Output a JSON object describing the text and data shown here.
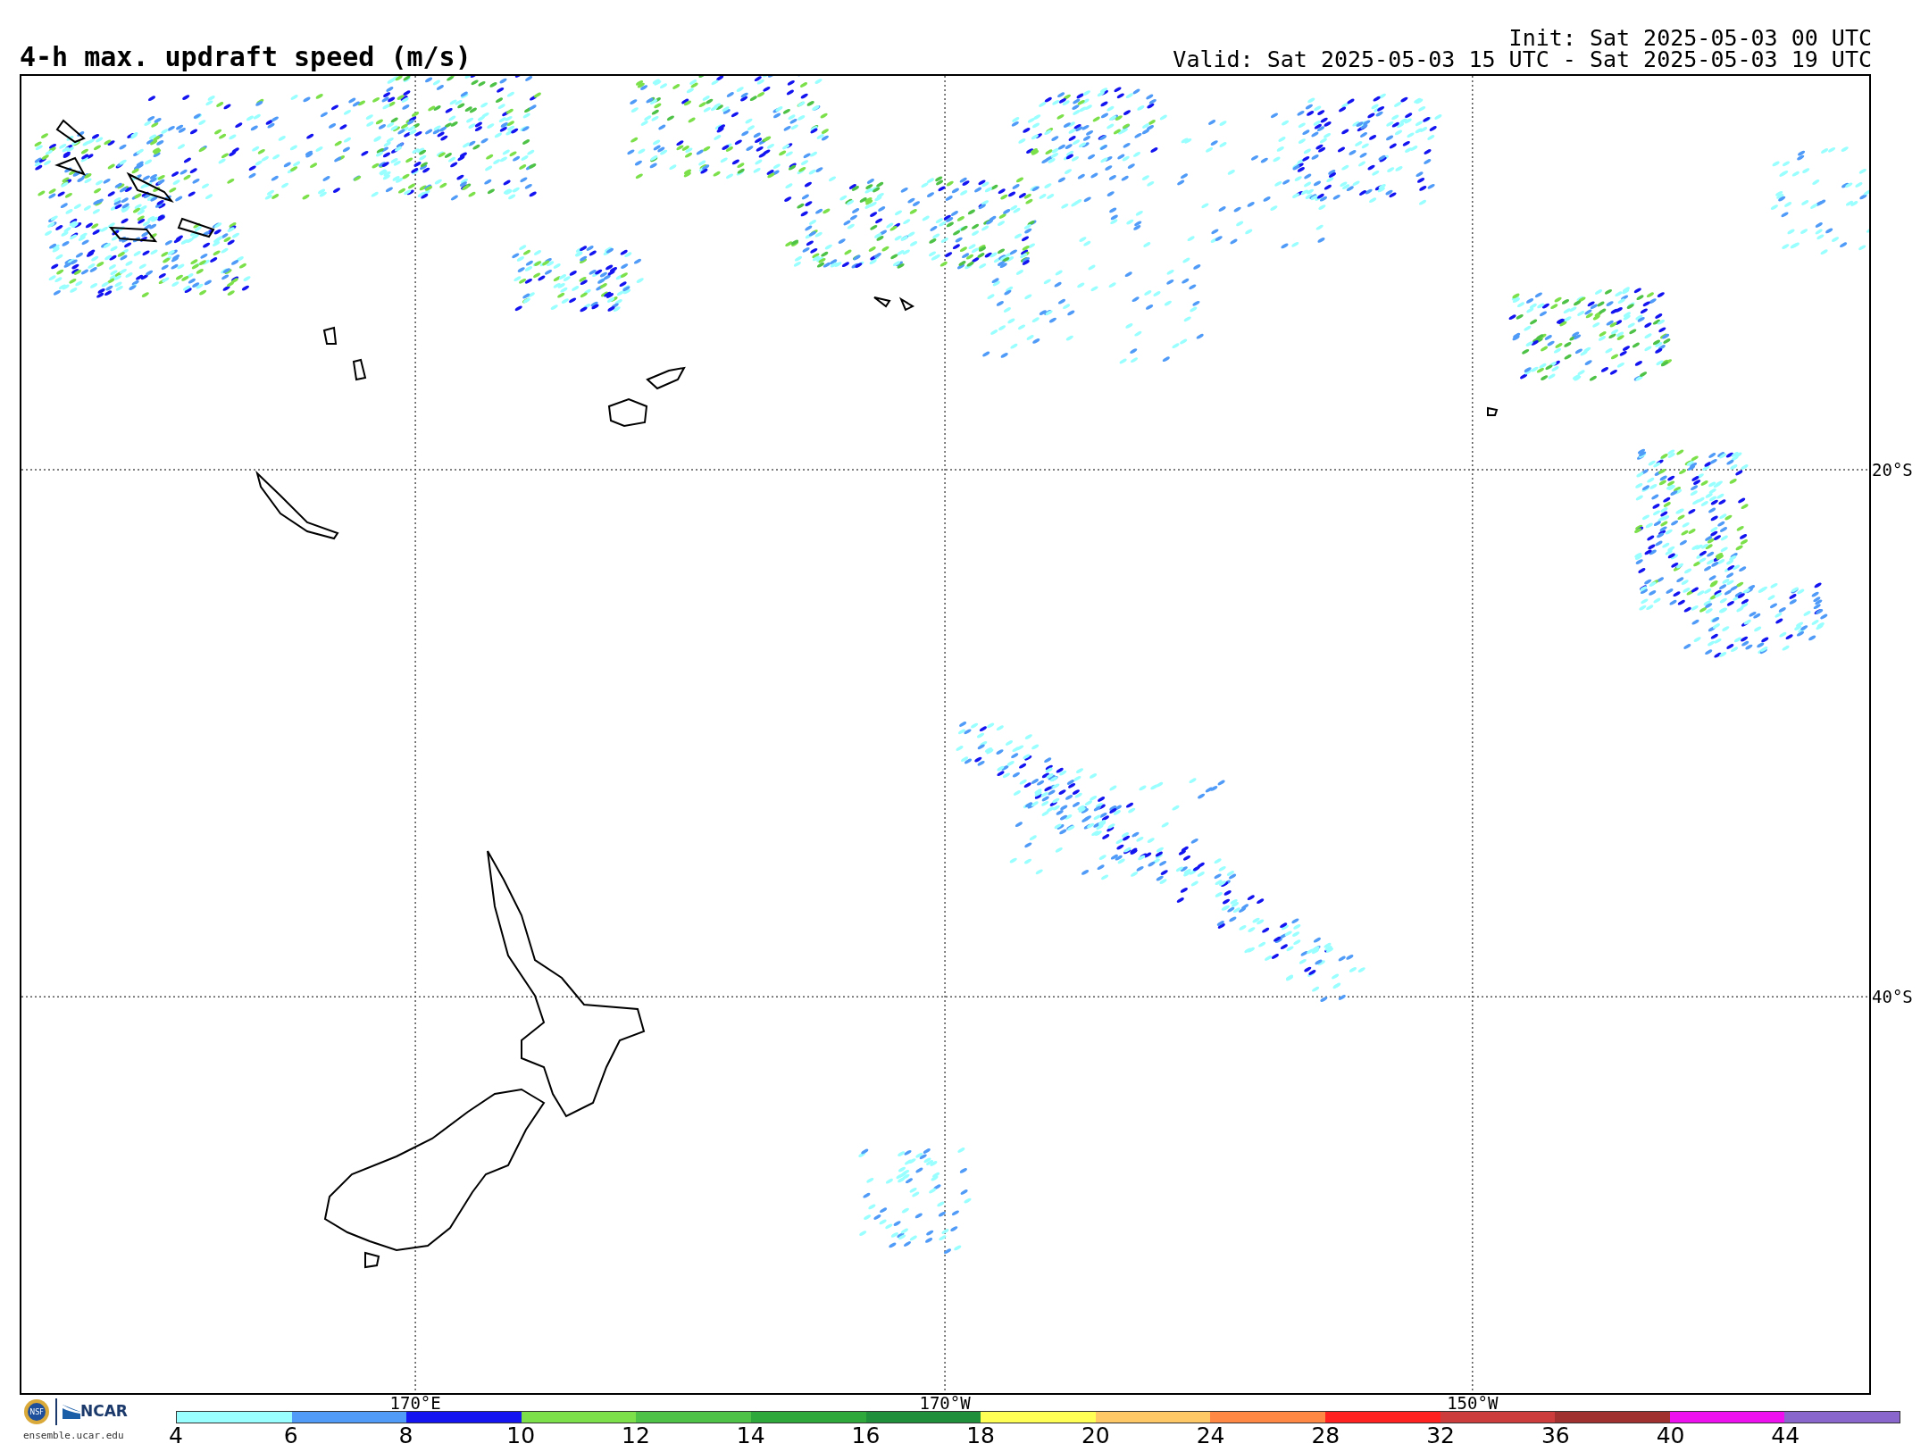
{
  "title": "4-h max. updraft speed (m/s)",
  "init": "Init: Sat 2025-05-03 00 UTC",
  "valid": "Valid: Sat 2025-05-03 15 UTC - Sat 2025-05-03 19 UTC",
  "map": {
    "lon_labels": [
      "170°E",
      "170°W",
      "150°W"
    ],
    "lat_labels": [
      "20°S",
      "40°S"
    ]
  },
  "logos": {
    "seal": "NSF",
    "org": "NCAR",
    "site": "ensemble.ucar.edu"
  },
  "colorbar": {
    "segments": [
      {
        "color": "#99ffff"
      },
      {
        "color": "#4f9bf7"
      },
      {
        "color": "#1414f0"
      },
      {
        "color": "#7ce04a"
      },
      {
        "color": "#4ec246"
      },
      {
        "color": "#2ea83a"
      },
      {
        "color": "#1f8f3c"
      },
      {
        "color": "#ffff55"
      },
      {
        "color": "#ffc866"
      },
      {
        "color": "#ff8844"
      },
      {
        "color": "#ff2020"
      },
      {
        "color": "#cc3c3c"
      },
      {
        "color": "#a03030"
      },
      {
        "color": "#ee10ee"
      },
      {
        "color": "#8866cc"
      }
    ],
    "ticks": [
      "4",
      "6",
      "8",
      "10",
      "12",
      "14",
      "16",
      "18",
      "20",
      "24",
      "28",
      "32",
      "36",
      "40",
      "44"
    ]
  }
}
